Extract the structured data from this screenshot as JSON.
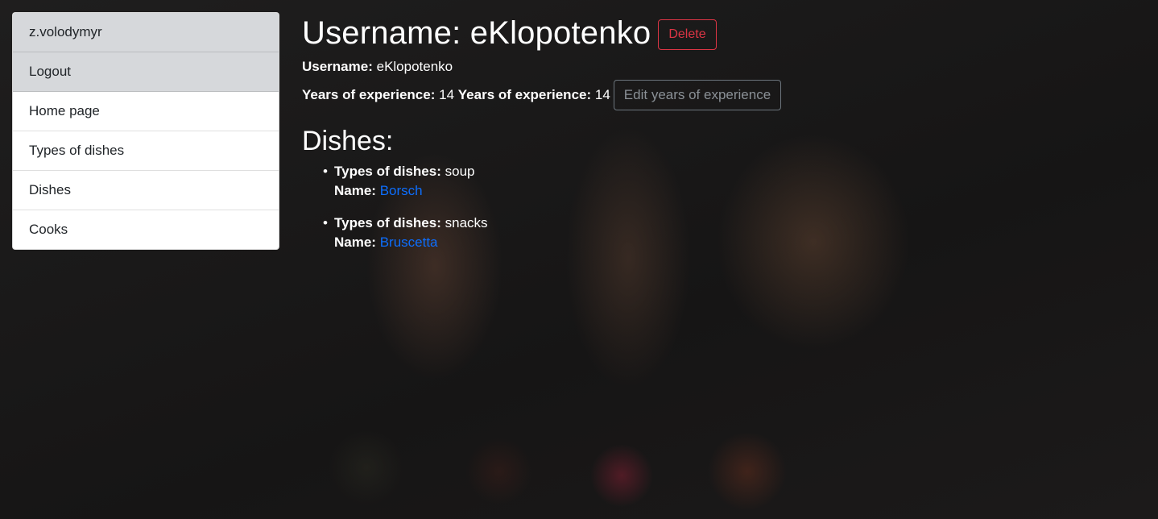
{
  "sidebar": {
    "items": [
      {
        "label": "z.volodymyr"
      },
      {
        "label": "Logout"
      },
      {
        "label": "Home page"
      },
      {
        "label": "Types of dishes"
      },
      {
        "label": "Dishes"
      },
      {
        "label": "Cooks"
      }
    ]
  },
  "header": {
    "title": "Username: eKlopotenko",
    "delete_label": "Delete"
  },
  "details": {
    "username_label": "Username:",
    "username_value": "eKlopotenko",
    "years_label_1": "Years of experience:",
    "years_value_1": "14",
    "years_label_2": "Years of experience:",
    "years_value_2": "14",
    "edit_label": "Edit years of experience"
  },
  "dishes": {
    "heading": "Dishes:",
    "type_label": "Types of dishes:",
    "name_label": "Name:",
    "items": [
      {
        "type": "soup",
        "name": "Borsch"
      },
      {
        "type": "snacks",
        "name": "Bruscetta"
      }
    ]
  },
  "colors": {
    "danger": "#dc3545",
    "link": "#0d6efd",
    "muted_item_bg": "#d6d8db",
    "secondary_border": "#6c757d"
  }
}
